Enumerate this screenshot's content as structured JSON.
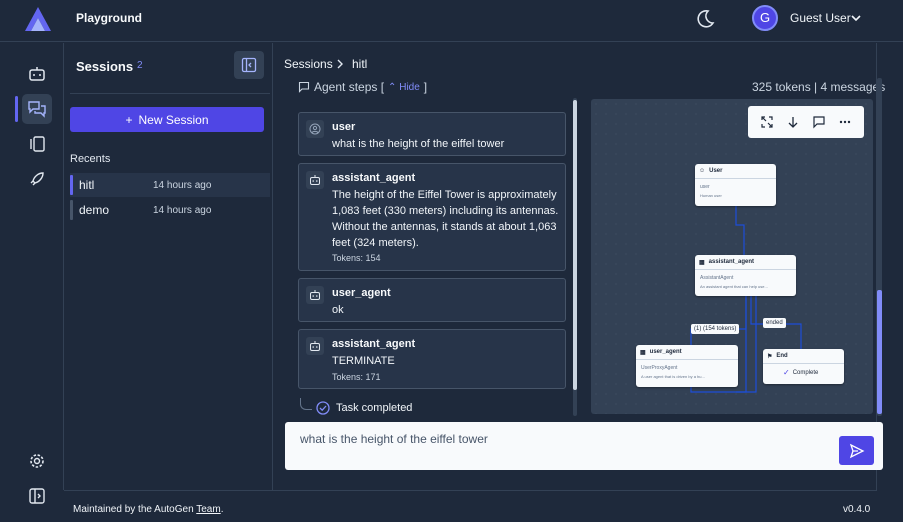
{
  "header": {
    "app_title": "Playground",
    "user_initial": "G",
    "user_name": "Guest User"
  },
  "sessions_panel": {
    "title": "Sessions",
    "count": "2",
    "new_session_label": "New Session",
    "recents_label": "Recents",
    "items": [
      {
        "name": "hitl",
        "time": "14 hours ago",
        "active": true
      },
      {
        "name": "demo",
        "time": "14 hours ago",
        "active": false
      }
    ]
  },
  "breadcrumb": {
    "root": "Sessions",
    "current": "hitl"
  },
  "steps": {
    "label": "Agent steps [",
    "toggle": "Hide",
    "close": "]",
    "token_summary": "325 tokens | 4 messages"
  },
  "messages": [
    {
      "who": "user",
      "text": "what is the height of the eiffel tower",
      "tokens": ""
    },
    {
      "who": "assistant_agent",
      "text": "The height of the Eiffel Tower is approximately 1,083 feet (330 meters) including its antennas. Without the antennas, it stands at about 1,063 feet (324 meters).",
      "tokens": "Tokens: 154"
    },
    {
      "who": "user_agent",
      "text": "ok",
      "tokens": ""
    },
    {
      "who": "assistant_agent",
      "text": "TERMINATE",
      "tokens": "Tokens: 171"
    }
  ],
  "task_status": "Task completed",
  "graph": {
    "nodes": {
      "user": {
        "title": "User",
        "type": "user",
        "desc": "Human user"
      },
      "assistant": {
        "title": "assistant_agent",
        "type": "AssistantAgent",
        "desc": "An assistant agent that can help use..."
      },
      "user_agent": {
        "title": "user_agent",
        "type": "UserProxyAgent",
        "desc": "A user agent that is driven by a hu..."
      },
      "end": {
        "title": "End",
        "status": "Complete"
      }
    },
    "edge_labels": {
      "tokens": "(1) (154 tokens)",
      "ended": "ended"
    }
  },
  "input": {
    "value": "what is the height of the eiffel tower"
  },
  "footer": {
    "text": "Maintained by the AutoGen ",
    "link": "Team",
    "suffix": ".",
    "version": "v0.4.0"
  },
  "colors": {
    "accent": "#4f46e5",
    "background": "#1e293b",
    "panel": "#273449"
  }
}
